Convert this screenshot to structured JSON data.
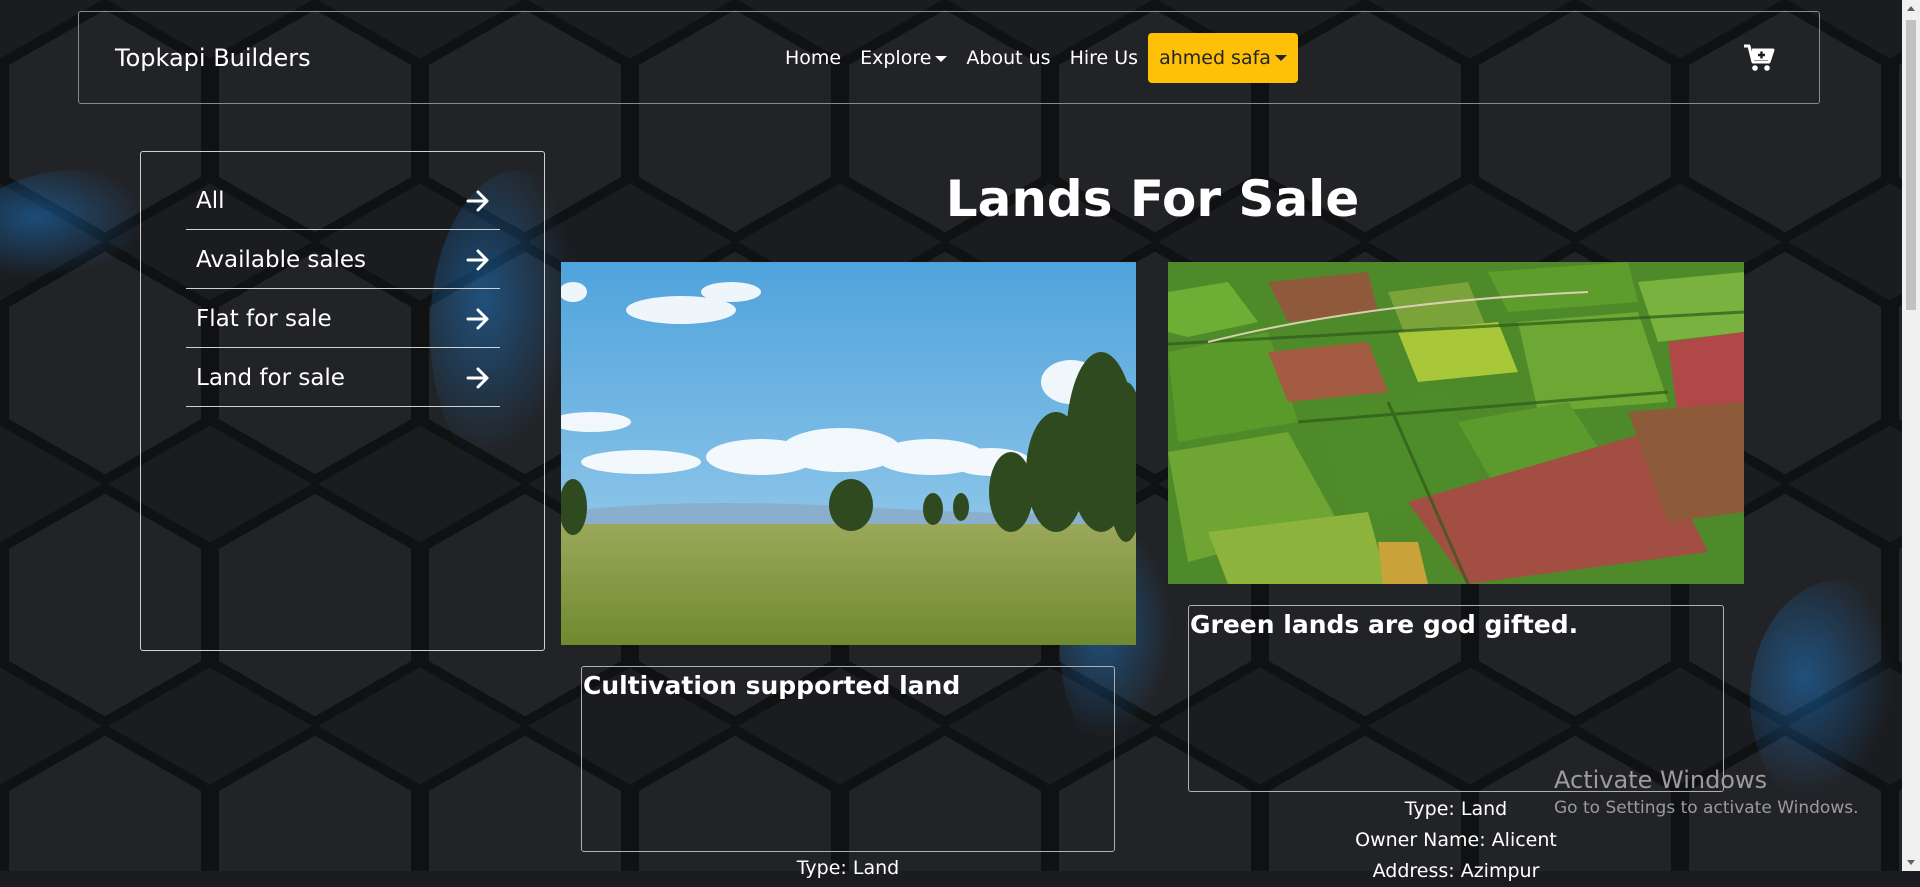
{
  "navbar": {
    "brand": "Topkapi Builders",
    "links": {
      "home": "Home",
      "explore": "Explore",
      "about": "About us",
      "hire": "Hire Us"
    },
    "user": "ahmed safa",
    "cart_icon": "cart-plus-icon"
  },
  "sidebar": {
    "items": [
      {
        "label": "All",
        "icon": "arrow-right-icon"
      },
      {
        "label": "Available sales",
        "icon": "arrow-right-icon"
      },
      {
        "label": "Flat for sale",
        "icon": "arrow-right-icon"
      },
      {
        "label": "Land for sale",
        "icon": "arrow-right-icon"
      }
    ]
  },
  "main": {
    "title": "Lands For Sale",
    "cards": [
      {
        "title": "Cultivation supported land",
        "type": "Type: Land"
      },
      {
        "title": "Green lands are god gifted.",
        "type": "Type: Land",
        "owner": "Owner Name: Alicent",
        "address": "Address: Azimpur"
      }
    ]
  },
  "watermark": {
    "line1": "Activate Windows",
    "line2": "Go to Settings to activate Windows."
  },
  "colors": {
    "background": "#1b1c1f",
    "accent": "#ffc107",
    "hex_glow": "#1e88e5"
  }
}
